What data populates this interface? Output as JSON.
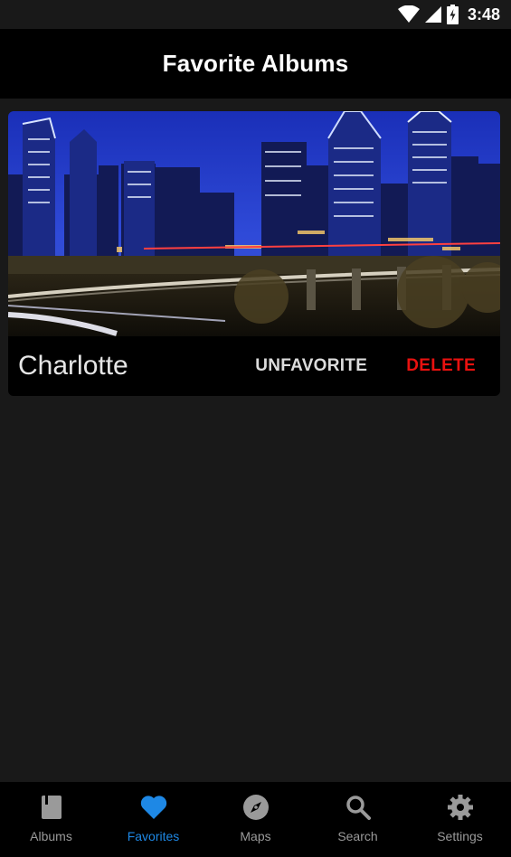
{
  "status_bar": {
    "time": "3:48",
    "icons": [
      "wifi-icon",
      "signal-icon",
      "battery-charging-icon"
    ]
  },
  "app_bar": {
    "title": "Favorite Albums"
  },
  "albums": [
    {
      "name": "Charlotte",
      "image": "city-skyline-night-photo",
      "unfavorite_label": "UNFAVORITE",
      "delete_label": "DELETE"
    }
  ],
  "bottom_nav": {
    "active": "Favorites",
    "items": [
      {
        "label": "Albums",
        "icon": "album-book-icon"
      },
      {
        "label": "Favorites",
        "icon": "heart-icon"
      },
      {
        "label": "Maps",
        "icon": "compass-icon"
      },
      {
        "label": "Search",
        "icon": "search-icon"
      },
      {
        "label": "Settings",
        "icon": "gear-icon"
      }
    ]
  },
  "colors": {
    "background": "#191919",
    "bar": "#000000",
    "accent": "#1e88e5",
    "delete": "#e8110f",
    "inactive": "#9a9a9a"
  }
}
